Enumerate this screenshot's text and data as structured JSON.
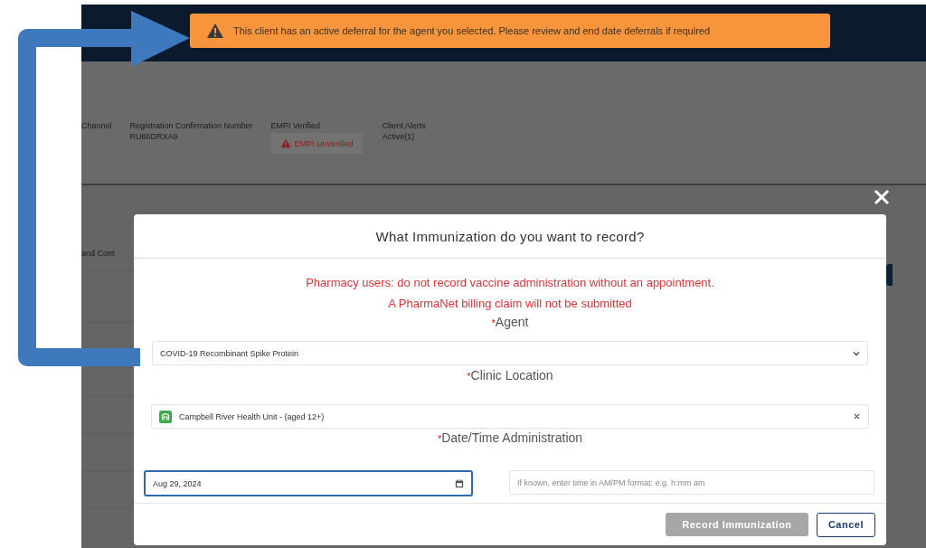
{
  "banner": {
    "text": "This client has an active deferral for the agent you selected. Please review and end date deferrals if required"
  },
  "header_fields": [
    {
      "label": "Channel"
    },
    {
      "label": "Registration Confirmation Number",
      "value": "RU86DRXA9"
    },
    {
      "label": "EMPI Verified",
      "badge": "EMPI Unverified"
    },
    {
      "label": "Client Alerts",
      "value": "Active(1)"
    }
  ],
  "section_label": "and Cont",
  "modal": {
    "title": "What Immunization do you want to record?",
    "notices": [
      "Pharmacy users: do not record vaccine administration without an appointment.",
      "A PharmaNet billing claim will not be submitted"
    ],
    "fields": [
      {
        "kind": "select",
        "required_mark": "*",
        "label": "Agent",
        "value": "COVID-19 Recombinant Spike Protein"
      },
      {
        "kind": "lookup",
        "required_mark": "*",
        "label": "Clinic Location",
        "value": "Campbell River Health Unit - (aged 12+)"
      },
      {
        "kind": "datetime",
        "required_mark": "*",
        "label": "Date/Time Administration",
        "date_value": "Aug 29, 2024",
        "date_focused": true,
        "time_placeholder": "If known, enter time in AM/PM format: e.g. h:mm am"
      }
    ],
    "buttons": [
      {
        "label": "Record Immunization",
        "disabled": true
      },
      {
        "label": "Cancel",
        "disabled": false
      }
    ]
  }
}
